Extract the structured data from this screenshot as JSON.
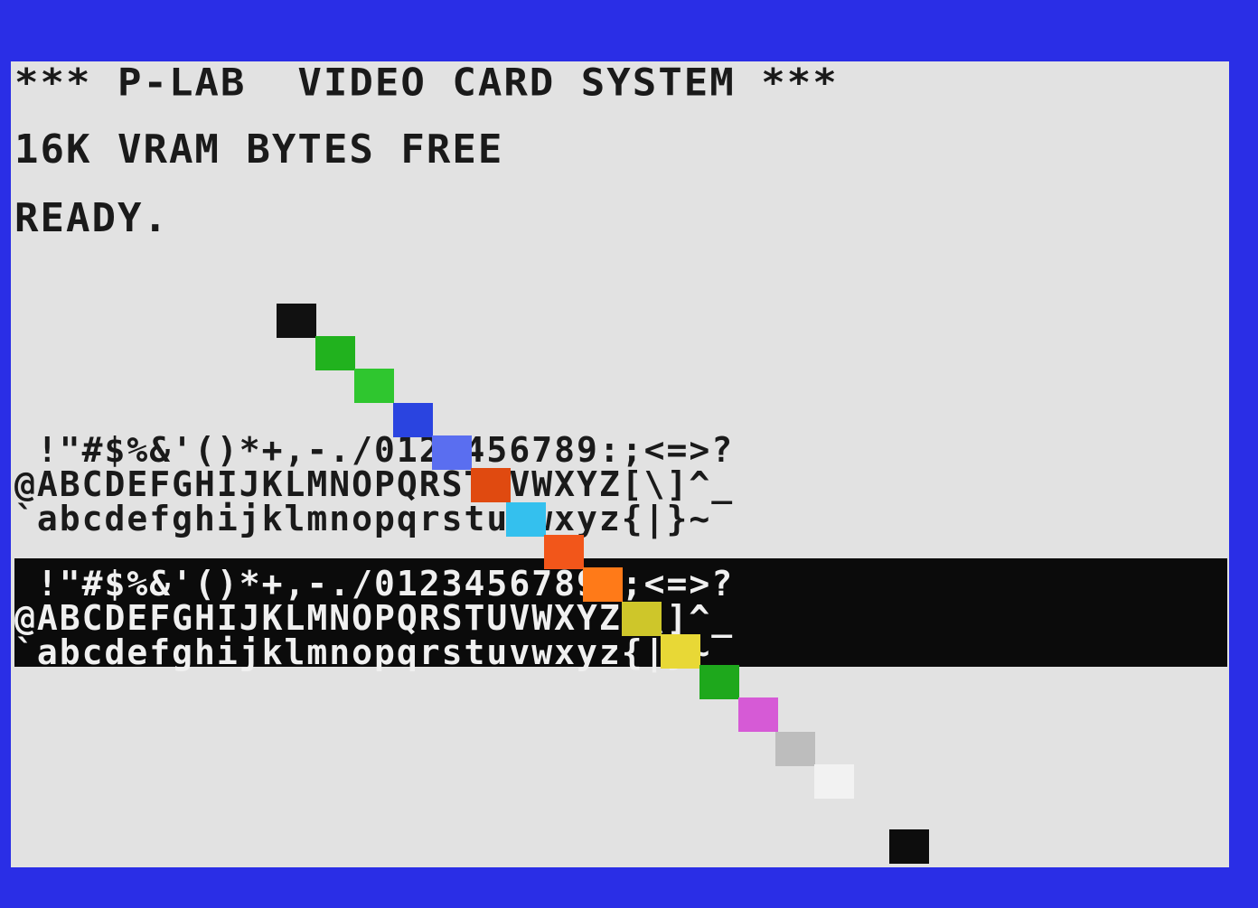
{
  "screen": {
    "boot": {
      "title": "*** P-LAB  VIDEO CARD SYSTEM ***",
      "memory": "16K VRAM BYTES FREE",
      "ready": "READY."
    },
    "charset_normal": [
      " !\"#$%&'()*+,-./0123456789:;<=>?",
      "@ABCDEFGHIJKLMNOPQRSTUVWXYZ[\\]^_",
      "`abcdefghijklmnopqrstuvwxyz{|}~"
    ],
    "charset_inverse": [
      " !\"#$%&'()*+,-./0123456789:;<=>?",
      "@ABCDEFGHIJKLMNOPQRSTUVWXYZ[\\]^_",
      "`abcdefghijklmnopqrstuvwxyz{|}~"
    ],
    "colors": {
      "border": "#2a2ee6",
      "background": "#e2e2e2",
      "text": "#1a1a1a",
      "inverse_background": "#0b0b0b",
      "inverse_text": "#f0f0f0"
    },
    "color_tiles": [
      {
        "name": "black",
        "color": "#111111"
      },
      {
        "name": "green",
        "color": "#21b21e"
      },
      {
        "name": "light-green",
        "color": "#2fc62f"
      },
      {
        "name": "dark-blue",
        "color": "#2a44e0"
      },
      {
        "name": "light-blue",
        "color": "#5a6ef0"
      },
      {
        "name": "dark-red",
        "color": "#e04a10"
      },
      {
        "name": "cyan",
        "color": "#34c0ee"
      },
      {
        "name": "medium-red",
        "color": "#f2561a"
      },
      {
        "name": "light-red",
        "color": "#ff7a18"
      },
      {
        "name": "dark-yellow",
        "color": "#cec62a"
      },
      {
        "name": "light-yellow",
        "color": "#e8d836"
      },
      {
        "name": "dark-green",
        "color": "#1ea81c"
      },
      {
        "name": "magenta",
        "color": "#d65ad6"
      },
      {
        "name": "gray",
        "color": "#bdbdbd"
      },
      {
        "name": "white",
        "color": "#f2f2f2"
      },
      {
        "name": "black-2",
        "color": "#0d0d0d"
      }
    ]
  }
}
